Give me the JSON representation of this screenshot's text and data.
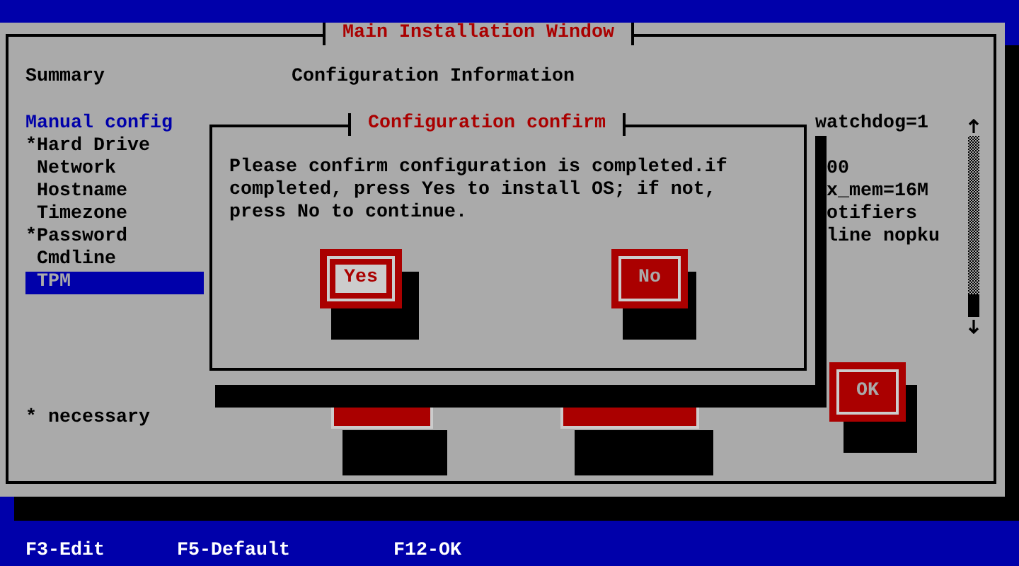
{
  "main_window": {
    "title": "Main Installation Window",
    "summary_label": "Summary",
    "info_heading": "Configuration Information",
    "menu": {
      "heading": "Manual config",
      "items": [
        {
          "label": "*Hard Drive",
          "selected": false
        },
        {
          "label": " Network",
          "selected": false
        },
        {
          "label": " Hostname",
          "selected": false
        },
        {
          "label": " Timezone",
          "selected": false
        },
        {
          "label": "*Password",
          "selected": false
        },
        {
          "label": " Cmdline",
          "selected": false
        },
        {
          "label": " TPM",
          "selected": true
        }
      ]
    },
    "info_lines": [
      "watchdog=1",
      "00",
      "x_mem=16M",
      "otifiers",
      "line nopku"
    ],
    "ok_button": {
      "label": "OK",
      "selected": false
    },
    "note": "* necessary"
  },
  "dialog": {
    "title": "Configuration confirm",
    "message": "Please confirm configuration is completed.if completed, press Yes to install OS; if not, press No to continue.",
    "buttons": [
      {
        "label": "Yes",
        "selected": true
      },
      {
        "label": "No",
        "selected": false
      }
    ]
  },
  "keys": [
    "F3-Edit",
    "F5-Default",
    "F12-OK"
  ]
}
